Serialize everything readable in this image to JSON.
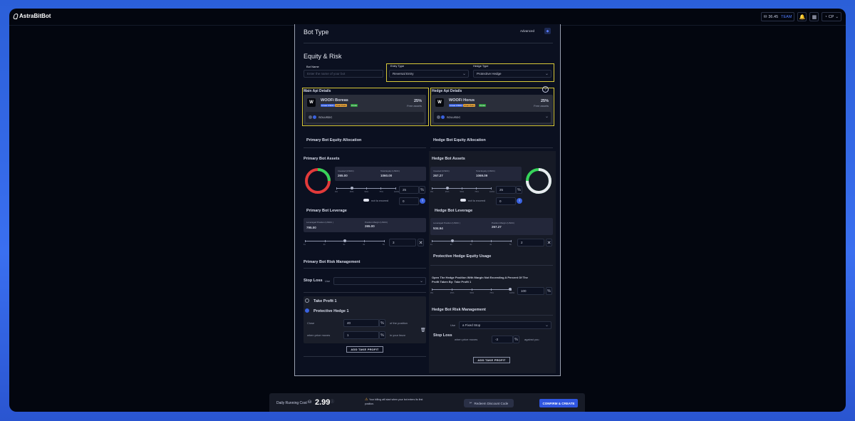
{
  "app": {
    "logo": "AstraBitBot"
  },
  "topbar": {
    "balance": "36.45",
    "tier": "TEAM",
    "user": "CP"
  },
  "header": {
    "bot_type": "Bot Type",
    "advanced": "Advanced"
  },
  "equity_risk": {
    "title": "Equity & Risk",
    "bot_name_label": "Bot Name",
    "bot_name_placeholder": "Enter the name of your bot",
    "entry_type_label": "Entry Type",
    "entry_type_value": "Reversal Entry",
    "hedge_type_label": "Hedge Type",
    "hedge_type_value": "Protective Hedge"
  },
  "main_api": {
    "title": "Main Api Details",
    "exchange": "WOOFi Boreas",
    "badges": [
      "Linear USDC",
      "Chart Pairs",
      "Cross"
    ],
    "pct": "25%",
    "free_assets": "Free assets",
    "pair": "SOLUSDC"
  },
  "hedge_api": {
    "title": "Hedge Api Details",
    "exchange": "WOOFi Horus",
    "badges": [
      "Linear USDC",
      "Chart Pairs",
      "Cross"
    ],
    "pct": "25%",
    "free_assets": "Free assets",
    "pair": "SOLUSDC"
  },
  "primary": {
    "equity_alloc": "Primary Bot Equity Allocation",
    "assets_title": "Primary Bot Assets",
    "invested_label": "Invested (USDC)",
    "invested_value": "265.00",
    "total_equity_label": "Total Equity (USDC)",
    "total_equity_value": "1060.00",
    "alloc_pct": "25",
    "alloc_fraction": 0.25,
    "not_to_exceed": "not to exceed",
    "not_to_exceed_value": "0",
    "leverage_title": "Primary Bot Leverage",
    "lev_pos_label": "Leveraged Position (USDC )",
    "lev_pos_value": "795.00",
    "pos_margin_label": "Position Margin (USDC)",
    "pos_margin_value": "265.00",
    "leverage_value": "3",
    "risk_title": "Primary Bot Risk Management",
    "stop_loss": "Stop Loss",
    "use": "Use",
    "take_profit": "Take Profit 1",
    "protective_hedge": "Protective Hedge 1",
    "close_label": "Close",
    "close_value": "40",
    "of_position": "of the position",
    "when_moves": "when price moves",
    "moves_value": "1",
    "in_favor": "in your favor",
    "add_tp": "ADD TAKE PROFIT"
  },
  "hedge": {
    "equity_alloc": "Hedge Bot Equity Allocation",
    "assets_title": "Hedge Bot Assets",
    "invested_label": "Invested (USDC)",
    "invested_value": "267.27",
    "total_equity_label": "Total Equity (USDC)",
    "total_equity_value": "1069.09",
    "alloc_pct": "25",
    "alloc_fraction": 0.25,
    "not_to_exceed": "not to exceed",
    "not_to_exceed_value": "0",
    "leverage_title": "Hedge Bot Leverage",
    "lev_pos_label": "Leveraged Position (USDC )",
    "lev_pos_value": "534.54",
    "pos_margin_label": "Position Margin (USDC)",
    "pos_margin_value": "267.27",
    "leverage_value": "2",
    "protective_usage": "Protective Hedge Equity Usage",
    "open_desc_1": "Open The Hedge Position With Margin Not Exceeding A Percent Of The",
    "open_desc_2": "Profit Taken By: Take Profit 1",
    "usage_value": "100",
    "risk_title": "Hedge Bot Risk Management",
    "stop_loss": "Stop Loss",
    "use": "Use",
    "stop_type": "a Fixed Stop",
    "when_moves": "when price moves",
    "moves_value": "-3",
    "against": "against you",
    "add_tp": "ADD TAKE PROFIT"
  },
  "slider_ticks": [
    "0%",
    "25%",
    "50%",
    "75%",
    "100%"
  ],
  "lev_ticks": [
    "1x",
    "2x",
    "3x",
    "4x",
    "5x"
  ],
  "bottom": {
    "daily_cost_label": "Daily Running Cost",
    "daily_cost_value": "2.99",
    "billing_note_1": "Your billing will start when your bot enters its first",
    "billing_note_2": "position.",
    "redeem": "Redeem Discount Code",
    "confirm": "CONFIRM & CREATE"
  },
  "colors": {
    "accent": "#3a62e0",
    "highlight": "#d8c838",
    "donut_red": "#e23a3a",
    "donut_green": "#36d35a"
  }
}
